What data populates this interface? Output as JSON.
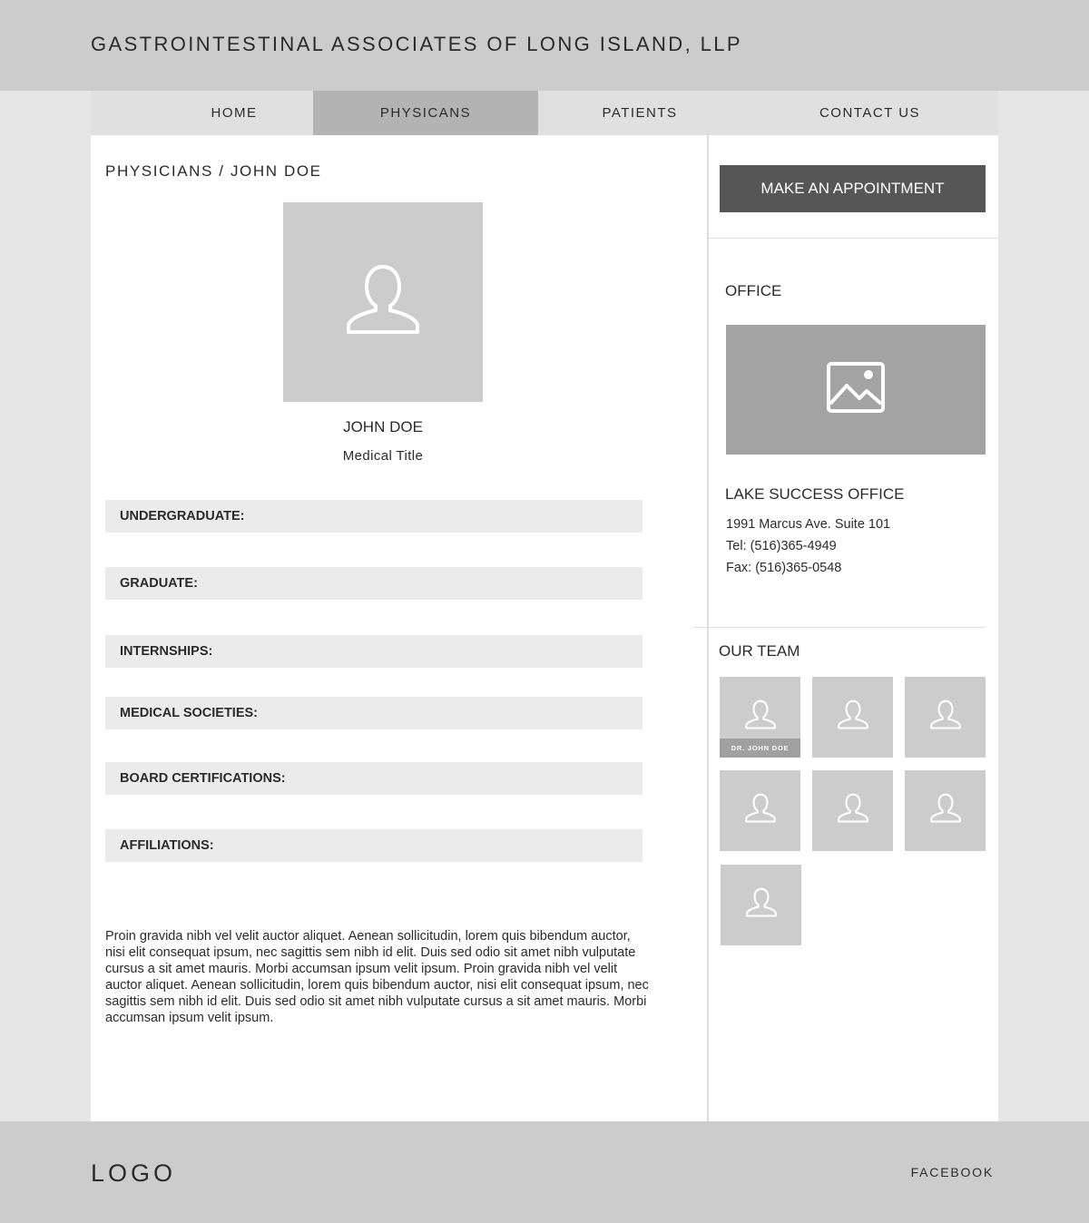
{
  "header": {
    "title": "GASTROINTESTINAL ASSOCIATES OF LONG ISLAND, LLP"
  },
  "nav": {
    "items": [
      {
        "label": "HOME",
        "active": false
      },
      {
        "label": "PHYSICANS",
        "active": true
      },
      {
        "label": "PATIENTS",
        "active": false
      },
      {
        "label": "CONTACT US",
        "active": false
      }
    ]
  },
  "main": {
    "breadcrumb": "PHYSICIANS / JOHN DOE",
    "photo_icon": "user-avatar-icon",
    "name": "JOHN DOE",
    "title": "Medical Title",
    "sections": [
      "UNDERGRADUATE:",
      "GRADUATE:",
      "INTERNSHIPS:",
      "MEDICAL SOCIETIES:",
      "BOARD CERTIFICATIONS:",
      "AFFILIATIONS:"
    ],
    "bio": "Proin gravida nibh vel velit auctor aliquet. Aenean sollicitudin, lorem quis bibendum auctor, nisi elit consequat ipsum, nec sagittis sem nibh id elit. Duis sed odio sit amet nibh vulputate cursus a sit amet mauris. Morbi accumsan ipsum velit ipsum. Proin gravida nibh vel velit auctor aliquet. Aenean sollicitudin, lorem quis bibendum auctor, nisi elit consequat ipsum, nec sagittis sem nibh id elit. Duis sed odio sit amet nibh vulputate cursus a sit amet mauris. Morbi accumsan ipsum velit ipsum."
  },
  "sidebar": {
    "appointment_button": "MAKE AN APPOINTMENT",
    "office_heading": "OFFICE",
    "office_image_icon": "image-placeholder-icon",
    "office_name": "LAKE SUCCESS OFFICE",
    "office_address": "1991 Marcus Ave. Suite 101",
    "office_tel": "Tel: (516)365-4949",
    "office_fax": "Fax: (516)365-0548",
    "team_heading": "OUR TEAM",
    "team_members": [
      {
        "caption": "DR. JOHN  DOE"
      },
      {
        "caption": ""
      },
      {
        "caption": ""
      },
      {
        "caption": ""
      },
      {
        "caption": ""
      },
      {
        "caption": ""
      },
      {
        "caption": ""
      }
    ]
  },
  "footer": {
    "logo": "LOGO",
    "link": "FACEBOOK"
  },
  "colors": {
    "header_bg": "#cccccc",
    "nav_bg": "#e0e0e0",
    "nav_active_bg": "#b3b3b3",
    "button_bg": "#565656",
    "placeholder_bg": "#cccccc"
  }
}
